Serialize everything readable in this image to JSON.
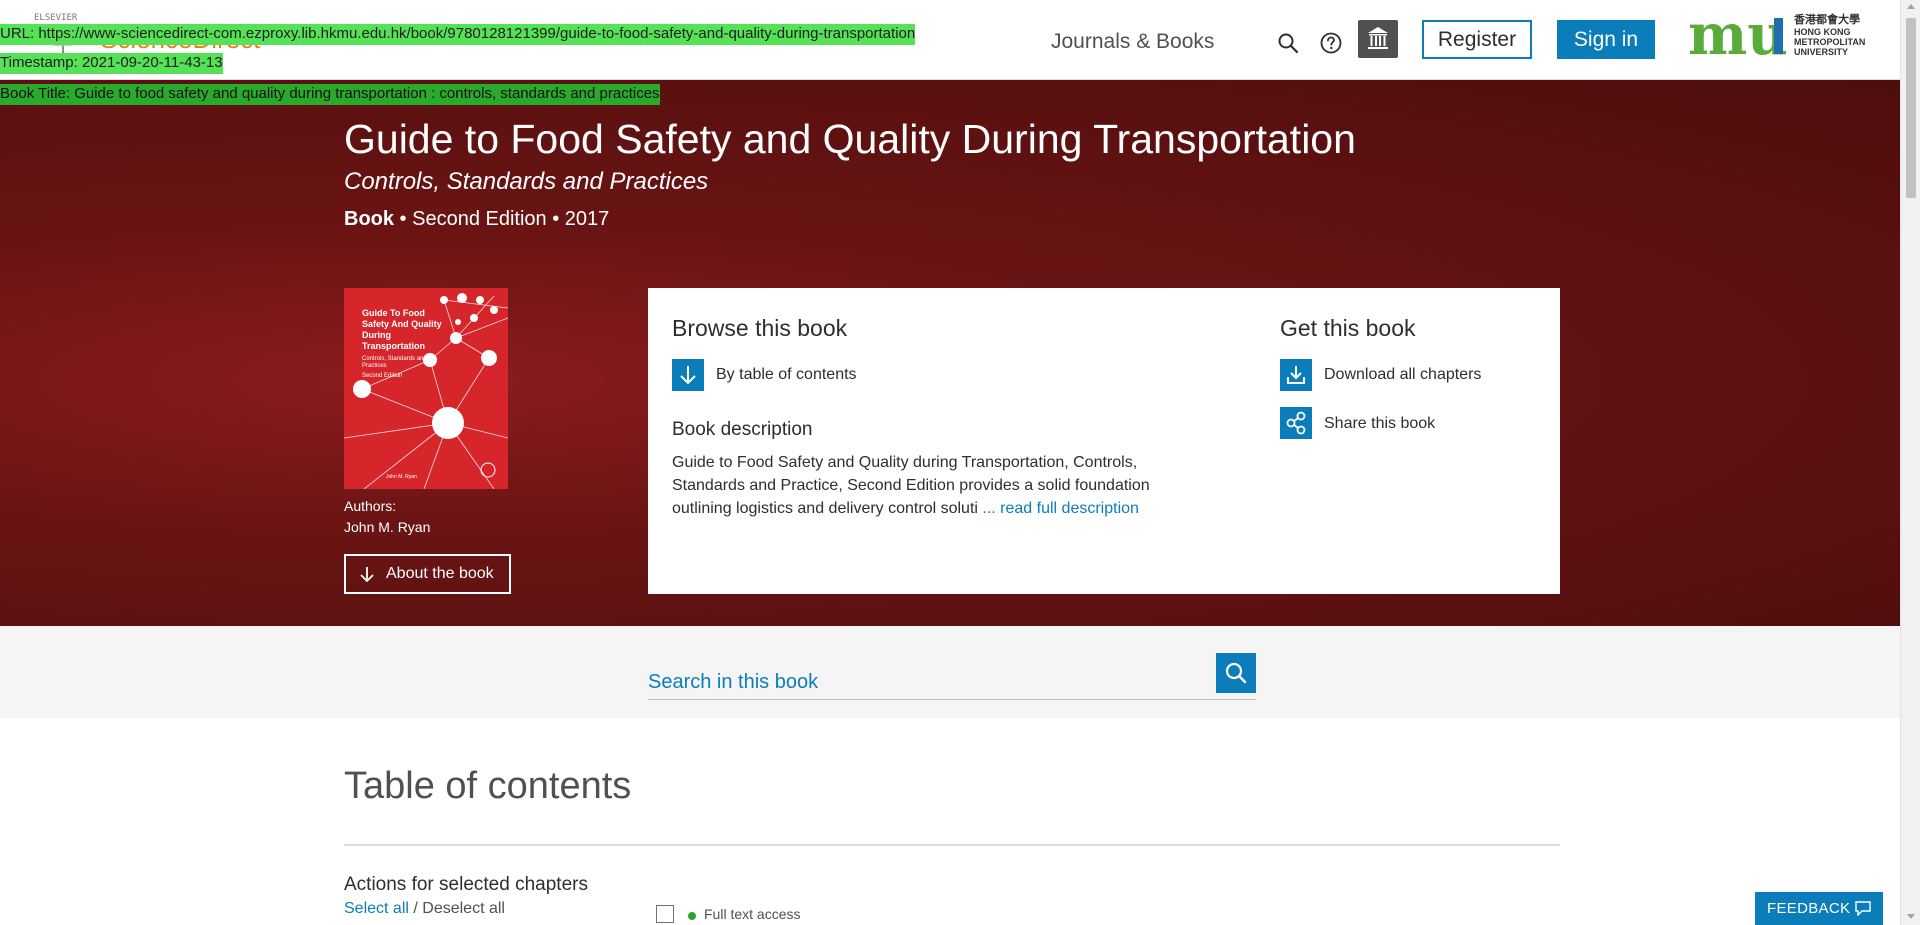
{
  "header": {
    "logo_text": "ScienceDirect",
    "logo_mark_text": "ELSEVIER",
    "nav_journals": "Journals & Books",
    "search_icon": "search-icon",
    "help_icon": "help-icon",
    "institution_icon": "institution-icon",
    "register_label": "Register",
    "signin_label": "Sign in",
    "institution_logo": {
      "letters": "mu",
      "line1": "香港都會大學",
      "line2": "HONG KONG",
      "line3": "METROPOLITAN",
      "line4": "UNIVERSITY"
    }
  },
  "overlay": {
    "url": "URL: https://www-sciencedirect-com.ezproxy.lib.hkmu.edu.hk/book/9780128121399/guide-to-food-safety-and-quality-during-transportation",
    "timestamp": "Timestamp: 2021-09-20-11-43-13",
    "book_title": "Book Title: Guide to food safety and quality during transportation : controls, standards and practices"
  },
  "hero": {
    "title": "Guide to Food Safety and Quality During Transportation",
    "subtitle": "Controls, Standards and Practices",
    "type": "Book",
    "meta_rest": " • Second Edition • 2017",
    "cover": {
      "title": "Guide To Food Safety And Quality During Transportation",
      "subtitle": "Controls, Standards and Practices",
      "edition": "Second Edition",
      "author": "John M. Ryan"
    },
    "authors_label": "Authors:",
    "author_name": "John M. Ryan",
    "about_label": "About the book"
  },
  "browse": {
    "heading": "Browse this book",
    "toc_link": "By table of contents",
    "desc_heading": "Book description",
    "desc_text": "Guide to Food Safety and Quality during Transportation, Controls, Standards and Practice, Second Edition provides a solid foundation outlining logistics and delivery control soluti",
    "read_more": "... read full description"
  },
  "get": {
    "heading": "Get this book",
    "download": "Download all chapters",
    "share": "Share this book"
  },
  "search": {
    "placeholder": "Search in this book"
  },
  "toc": {
    "title": "Table of contents",
    "actions_heading": "Actions for selected chapters",
    "select_all": "Select all",
    "separator": " / ",
    "deselect_all": "Deselect all",
    "full_text_access": "Full text access"
  },
  "feedback": {
    "label": "FEEDBACK"
  },
  "colors": {
    "brand_blue": "#0c7dbb",
    "hero_red": "#5e1010",
    "sciencedirect_orange": "#f07d1b",
    "overlay_green": "#56e256"
  }
}
